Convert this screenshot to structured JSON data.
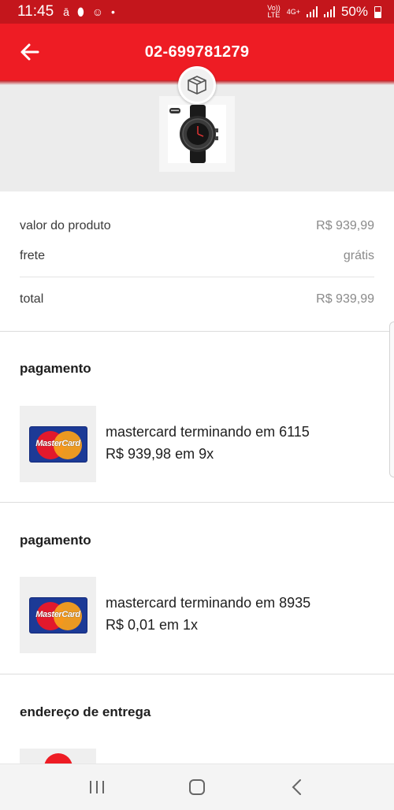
{
  "status_bar": {
    "time": "11:45",
    "icons": [
      "a-icon",
      "fish-icon",
      "android-icon",
      "dot-icon"
    ],
    "network_top": "Vo))",
    "network_bottom": "LTE",
    "net_4g": "4G+",
    "battery": "50%"
  },
  "header": {
    "title": "02-699781279",
    "accent_color": "#ee1c24"
  },
  "summary": {
    "product_label": "valor do produto",
    "product_value": "R$ 939,99",
    "shipping_label": "frete",
    "shipping_value": "grátis",
    "total_label": "total",
    "total_value": "R$ 939,99"
  },
  "payments": [
    {
      "title": "pagamento",
      "card_brand": "MasterCard",
      "line1": "mastercard terminando em 6115",
      "line2": "R$ 939,98 em 9x"
    },
    {
      "title": "pagamento",
      "card_brand": "MasterCard",
      "line1": "mastercard terminando em 8935",
      "line2": "R$ 0,01 em 1x"
    }
  ],
  "address": {
    "title": "endereço de entrega"
  },
  "nav": [
    "recent-apps-icon",
    "home-icon",
    "back-icon"
  ]
}
